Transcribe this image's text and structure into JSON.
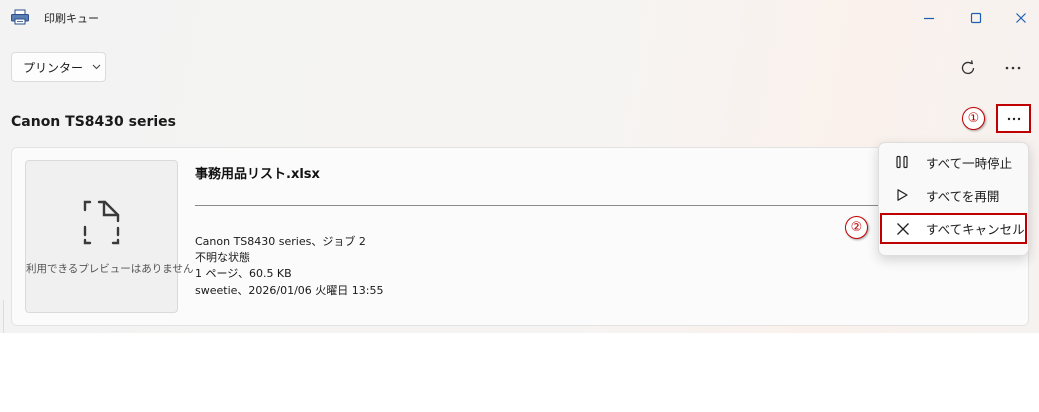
{
  "window": {
    "title": "印刷キュー",
    "app_icon": "printer-icon",
    "controls": [
      "minimize-icon",
      "maximize-icon",
      "close-icon"
    ]
  },
  "toolbar": {
    "printer_dropdown_label": "プリンター",
    "refresh_icon": "refresh-icon",
    "more_icon": "more-icon"
  },
  "printer": {
    "name": "Canon TS8430 series",
    "more_icon": "more-icon"
  },
  "annotations": [
    "①",
    "②"
  ],
  "job": {
    "preview_text": "利用できるプレビューはありません",
    "document_name": "事務用品リスト.xlsx",
    "details": [
      "Canon TS8430 series、ジョブ 2",
      "不明な状態",
      "1 ページ、60.5 KB",
      "sweetie、2026/01/06 火曜日 13:55"
    ]
  },
  "context_menu": {
    "items": [
      {
        "label": "すべて一時停止",
        "icon": "pause-icon"
      },
      {
        "label": "すべてを再開",
        "icon": "play-icon"
      },
      {
        "label": "すべてキャンセル",
        "icon": "cancel-x-icon"
      }
    ]
  },
  "colors": {
    "accent": "#1a5fb4",
    "annotation_red": "#c00000",
    "background": "#f3f3f3"
  }
}
